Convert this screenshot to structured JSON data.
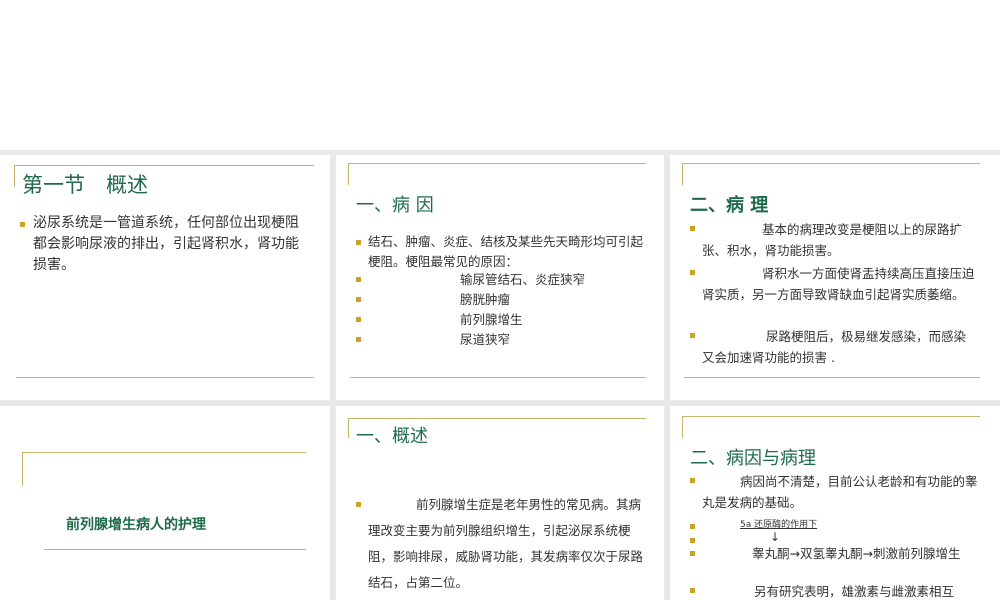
{
  "slides": [
    {
      "title": "第一节　概述",
      "bullets": [
        "泌尿系统是一管道系统，任何部位出现梗阻都会影响尿液的排出，引起肾积水，肾功能损害。"
      ]
    },
    {
      "title": "一、病 因",
      "intro": "结石、肿瘤、炎症、结核及某些先天畸形均可引起梗阻。梗阻最常见的原因：",
      "items": [
        "输尿管结石、炎症狭窄",
        "膀胱肿瘤",
        "前列腺增生",
        "尿道狭窄"
      ]
    },
    {
      "title": "二、病 理",
      "bullets": [
        "基本的病理改变是梗阻以上的尿路扩张、积水，肾功能损害。",
        "肾积水一方面使肾盂持续高压直接压迫肾实质，另一方面导致肾缺血引起肾实质萎缩。",
        "尿路梗阻后，极易继发感染，而感染又会加速肾功能的损害 ."
      ]
    },
    {
      "title": "前列腺增生病人的护理"
    },
    {
      "title": "一、概述",
      "bullets": [
        "前列腺增生症是老年男性的常见病。其病理改变主要为前列腺组织增生，引起泌尿系统梗阻，影响排尿，威胁肾功能，其发病率仅次于尿路结石，占第二位。"
      ]
    },
    {
      "title": "二、病因与病理",
      "bullets": [
        "病因尚不清楚，目前公认老龄和有功能的睾丸是发病的基础。"
      ],
      "reaction_label": "5a 还原酶的作用下",
      "reaction_arrow": "↓",
      "reaction": "睾丸酮→双氢睾丸酮→刺激前列腺增生",
      "more": "另有研究表明，雄激素与雌激素相互"
    }
  ],
  "colors": {
    "title": "#1e6b4a",
    "accent": "#c9a227",
    "rule": "#c7b36a",
    "gap": "#e8e8e8"
  }
}
